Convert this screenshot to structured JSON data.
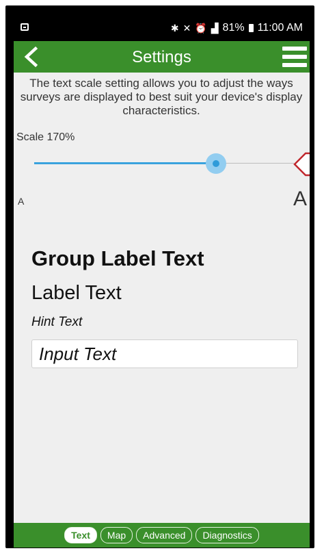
{
  "status_bar": {
    "battery": "81%",
    "time": "11:00 AM",
    "icons": [
      "bluetooth-icon",
      "mute-icon",
      "alarm-icon",
      "signal-icon",
      "battery-icon"
    ]
  },
  "app_bar": {
    "title": "Settings",
    "back_icon": "chevron-left-icon",
    "menu_icon": "hamburger-menu-icon"
  },
  "description": "The text scale setting allows you to adjust the ways surveys are displayed to best suit your device's display characteristics.",
  "scale": {
    "label": "Scale 170%",
    "value_fraction": 0.7,
    "min_label": "A",
    "max_label": "A"
  },
  "preview": {
    "group_label": "Group Label Text",
    "label": "Label Text",
    "hint": "Hint Text",
    "input_value": "Input Text"
  },
  "tabs": [
    {
      "label": "Text",
      "active": true
    },
    {
      "label": "Map",
      "active": false
    },
    {
      "label": "Advanced",
      "active": false
    },
    {
      "label": "Diagnostics",
      "active": false
    }
  ],
  "colors": {
    "green": "#3a8f2b",
    "accent_blue": "#3aa2dd",
    "callout_red": "#c0272d"
  }
}
